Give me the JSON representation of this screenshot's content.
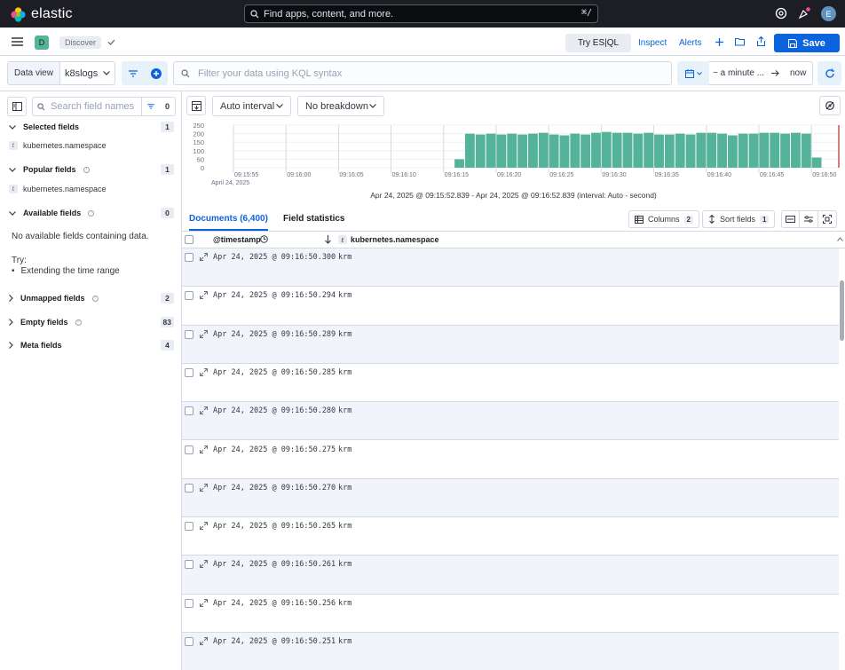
{
  "header": {
    "logo_text": "elastic",
    "search_placeholder": "Find apps, content, and more.",
    "search_shortcut": "⌘/",
    "user_initial": "E"
  },
  "appbar": {
    "space_initial": "D",
    "breadcrumb": "Discover",
    "try_esql": "Try ES|QL",
    "inspect": "Inspect",
    "alerts": "Alerts",
    "save": "Save"
  },
  "query": {
    "data_view_label": "Data view",
    "data_view_value": "k8slogs",
    "kql_placeholder": "Filter your data using KQL syntax",
    "date_start": "~ a minute ...",
    "date_end": "now"
  },
  "sidebar": {
    "search_placeholder": "Search field names",
    "filter_count": "0",
    "selected": {
      "label": "Selected fields",
      "count": "1",
      "items": [
        "kubernetes.namespace"
      ]
    },
    "popular": {
      "label": "Popular fields",
      "count": "1",
      "items": [
        "kubernetes.namespace"
      ]
    },
    "available": {
      "label": "Available fields",
      "count": "0",
      "empty_text": "No available fields containing data.",
      "try_label": "Try:",
      "try_item": "Extending the time range"
    },
    "unmapped": {
      "label": "Unmapped fields",
      "count": "2"
    },
    "empty": {
      "label": "Empty fields",
      "count": "83"
    },
    "meta": {
      "label": "Meta fields",
      "count": "4"
    }
  },
  "chart_controls": {
    "interval": "Auto interval",
    "breakdown": "No breakdown"
  },
  "chart_data": {
    "type": "bar",
    "title": "",
    "xlabel": "",
    "ylabel": "",
    "ylim": [
      0,
      250
    ],
    "y_ticks": [
      "250",
      "200",
      "150",
      "100",
      "50",
      "0"
    ],
    "x_ticks": [
      "09:15:55",
      "09:16:00",
      "09:16:05",
      "09:16:10",
      "09:16:15",
      "09:16:20",
      "09:16:25",
      "09:16:30",
      "09:16:35",
      "09:16:40",
      "09:16:45",
      "09:16:50"
    ],
    "x_sublabel": "April 24, 2025",
    "bar_color": "#54b399",
    "categories": [
      "09:16:16",
      "09:16:17",
      "09:16:18",
      "09:16:19",
      "09:16:20",
      "09:16:21",
      "09:16:22",
      "09:16:23",
      "09:16:24",
      "09:16:25",
      "09:16:26",
      "09:16:27",
      "09:16:28",
      "09:16:29",
      "09:16:30",
      "09:16:31",
      "09:16:32",
      "09:16:33",
      "09:16:34",
      "09:16:35",
      "09:16:36",
      "09:16:37",
      "09:16:38",
      "09:16:39",
      "09:16:40",
      "09:16:41",
      "09:16:42",
      "09:16:43",
      "09:16:44",
      "09:16:45",
      "09:16:46",
      "09:16:47",
      "09:16:48",
      "09:16:49",
      "09:16:50"
    ],
    "values": [
      50,
      200,
      195,
      200,
      195,
      200,
      195,
      200,
      205,
      195,
      190,
      200,
      195,
      205,
      210,
      205,
      205,
      200,
      205,
      195,
      195,
      200,
      195,
      205,
      205,
      200,
      190,
      200,
      200,
      205,
      205,
      200,
      205,
      200,
      60
    ]
  },
  "time_caption": "Apr 24, 2025 @ 09:15:52.839 - Apr 24, 2025 @ 09:16:52.839 (interval: Auto - second)",
  "grid": {
    "tab_documents": "Documents (6,400)",
    "tab_stats": "Field statistics",
    "columns_label": "Columns",
    "columns_count": "2",
    "sort_label": "Sort fields",
    "sort_count": "1",
    "col_timestamp": "@timestamp",
    "col_namespace": "kubernetes.namespace",
    "rows": [
      {
        "ts": "Apr 24, 2025 @ 09:16:50.300",
        "ns": "krm"
      },
      {
        "ts": "Apr 24, 2025 @ 09:16:50.294",
        "ns": "krm"
      },
      {
        "ts": "Apr 24, 2025 @ 09:16:50.289",
        "ns": "krm"
      },
      {
        "ts": "Apr 24, 2025 @ 09:16:50.285",
        "ns": "krm"
      },
      {
        "ts": "Apr 24, 2025 @ 09:16:50.280",
        "ns": "krm"
      },
      {
        "ts": "Apr 24, 2025 @ 09:16:50.275",
        "ns": "krm"
      },
      {
        "ts": "Apr 24, 2025 @ 09:16:50.270",
        "ns": "krm"
      },
      {
        "ts": "Apr 24, 2025 @ 09:16:50.265",
        "ns": "krm"
      },
      {
        "ts": "Apr 24, 2025 @ 09:16:50.261",
        "ns": "krm"
      },
      {
        "ts": "Apr 24, 2025 @ 09:16:50.256",
        "ns": "krm"
      },
      {
        "ts": "Apr 24, 2025 @ 09:16:50.251",
        "ns": "krm"
      }
    ]
  }
}
